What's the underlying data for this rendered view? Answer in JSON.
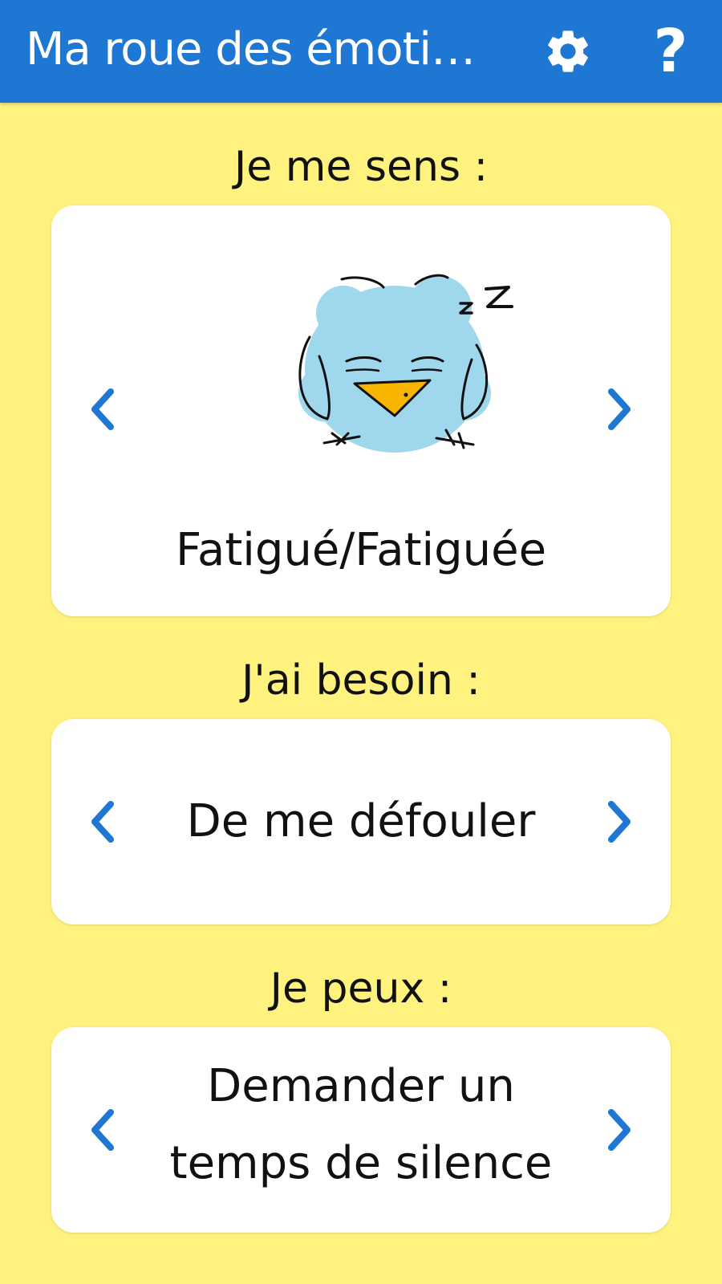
{
  "appbar": {
    "title": "Ma roue des émotio...",
    "settings_icon": "gear-icon",
    "help_icon": "question-mark-icon",
    "help_glyph": "?",
    "background": "#1E77D3"
  },
  "sections": {
    "feeling": {
      "heading": "Je me sens :",
      "value": "Fatigué/Fatiguée",
      "illustration": "sleeping-bird-illustration"
    },
    "need": {
      "heading": "J'ai besoin :",
      "value": "De me défouler"
    },
    "can": {
      "heading": "Je peux :",
      "value": "Demander un temps de silence"
    }
  },
  "colors": {
    "page_background": "#FFF27F",
    "accent": "#1E77D3",
    "card_background": "#FFFFFF"
  }
}
